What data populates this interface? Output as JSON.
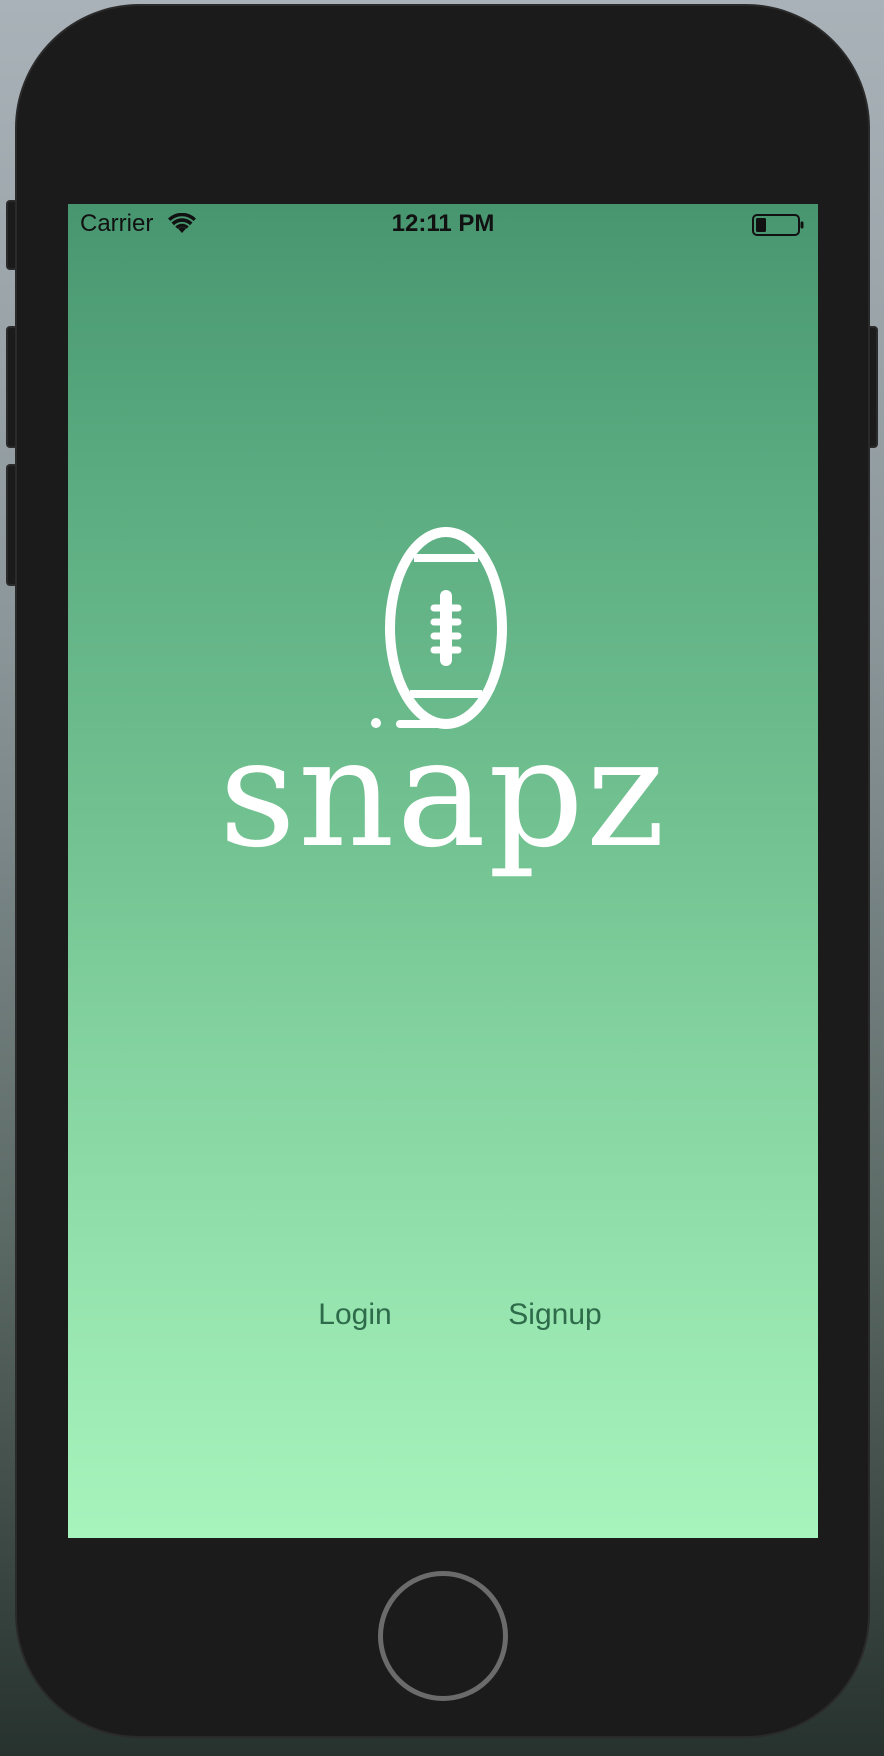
{
  "status_bar": {
    "carrier": "Carrier",
    "time": "12:11 PM",
    "wifi_icon": "wifi-icon",
    "battery_icon": "battery-icon",
    "battery_level": 0.25
  },
  "logo": {
    "icon": "football-icon",
    "wordmark": "snapz"
  },
  "actions": {
    "login_label": "Login",
    "signup_label": "Signup"
  },
  "colors": {
    "gradient_top": "#489670",
    "gradient_bottom": "#a8f4bd",
    "button_text": "#2e6b4a",
    "logo": "#ffffff"
  },
  "device": {
    "home_button_icon": "home-button"
  }
}
